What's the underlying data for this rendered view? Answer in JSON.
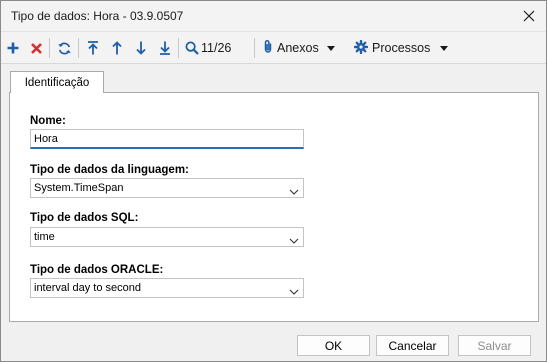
{
  "window": {
    "title": "Tipo de dados: Hora - 03.9.0507"
  },
  "toolbar": {
    "counter": "11/26",
    "attachments_label": "Anexos",
    "processes_label": "Processos",
    "colors": {
      "blue": "#1f5fa8",
      "red": "#d22f2f"
    }
  },
  "tabs": [
    {
      "label": "Identificação"
    }
  ],
  "form": {
    "name": {
      "label": "Nome:",
      "value": "Hora"
    },
    "language_type": {
      "label": "Tipo de dados da linguagem:",
      "value": "System.TimeSpan"
    },
    "sql_type": {
      "label": "Tipo de dados SQL:",
      "value": "time"
    },
    "oracle_type": {
      "label": "Tipo de dados ORACLE:",
      "value": "interval day to second"
    }
  },
  "footer": {
    "ok": "OK",
    "cancel": "Cancelar",
    "save": "Salvar"
  }
}
